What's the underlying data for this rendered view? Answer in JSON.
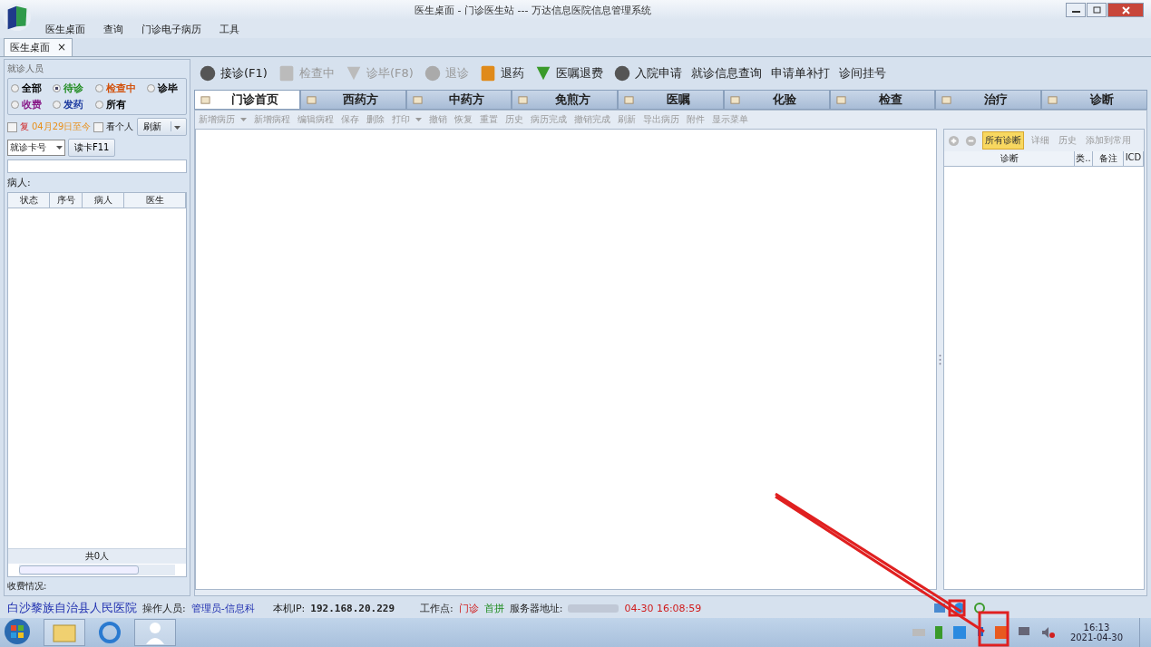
{
  "window": {
    "title": "医生桌面 - 门诊医生站 --- 万达信息医院信息管理系统"
  },
  "menu": [
    "医生桌面",
    "查询",
    "门诊电子病历",
    "工具"
  ],
  "doc_tabs": [
    {
      "label": "医生桌面",
      "selected": true,
      "close": "×"
    }
  ],
  "left_panel": {
    "title": "就诊人员",
    "filters": [
      {
        "label": "全部",
        "selected": false,
        "color": "#000000"
      },
      {
        "label": "待诊",
        "selected": true,
        "color": "#1e8a1e"
      },
      {
        "label": "检查中",
        "selected": false,
        "color": "#d2500a"
      },
      {
        "label": "诊毕",
        "selected": false,
        "color": "#000000"
      },
      {
        "label": "收费",
        "selected": false,
        "color": "#8a1e8a"
      },
      {
        "label": "发药",
        "selected": false,
        "color": "#1e3ca0"
      },
      {
        "label": "所有",
        "selected": false,
        "color": "#000000"
      }
    ],
    "recheck": {
      "label": "复",
      "checked": false
    },
    "date_range": "04月29日至今",
    "personal": {
      "label": "看个人",
      "checked": false
    },
    "refresh_button": "刷新",
    "card_type": "就诊卡号",
    "read_card_button": "读卡F11",
    "patients_label": "病人:",
    "patient_columns": [
      "状态",
      "序号",
      "病人",
      "医生"
    ],
    "patient_count": "共0人",
    "fee_label": "收费情况:"
  },
  "toolbar": [
    {
      "label": "接诊(F1)",
      "kind": "icon",
      "disabled": false
    },
    {
      "label": "检查中",
      "kind": "icon",
      "disabled": true
    },
    {
      "label": "诊毕(F8)",
      "kind": "icon",
      "disabled": true
    },
    {
      "label": "退诊",
      "kind": "icon",
      "disabled": true
    },
    {
      "label": "退药",
      "kind": "icon",
      "disabled": false
    },
    {
      "label": "医嘱退费",
      "kind": "icon",
      "disabled": false
    },
    {
      "label": "入院申请",
      "kind": "icon",
      "disabled": false
    },
    {
      "label": "就诊信息查询",
      "kind": "text",
      "disabled": false
    },
    {
      "label": "申请单补打",
      "kind": "text",
      "disabled": false
    },
    {
      "label": "诊间挂号",
      "kind": "text",
      "disabled": false
    }
  ],
  "module_tabs": [
    {
      "label": "门诊首页",
      "selected": true
    },
    {
      "label": "西药方",
      "selected": false
    },
    {
      "label": "中药方",
      "selected": false
    },
    {
      "label": "免煎方",
      "selected": false
    },
    {
      "label": "医嘱",
      "selected": false
    },
    {
      "label": "化验",
      "selected": false
    },
    {
      "label": "检查",
      "selected": false
    },
    {
      "label": "治疗",
      "selected": false
    },
    {
      "label": "诊断",
      "selected": false
    }
  ],
  "record_toolbar": [
    {
      "label": "新增病历",
      "dropdown": true
    },
    {
      "label": "新增病程",
      "dropdown": false
    },
    {
      "label": "编辑病程",
      "dropdown": false
    },
    {
      "label": "保存",
      "dropdown": false
    },
    {
      "label": "删除",
      "dropdown": false
    },
    {
      "label": "打印",
      "dropdown": true
    },
    {
      "label": "撤销",
      "dropdown": false
    },
    {
      "label": "恢复",
      "dropdown": false
    },
    {
      "label": "重置",
      "dropdown": false
    },
    {
      "label": "历史",
      "dropdown": false
    },
    {
      "label": "病历完成",
      "dropdown": false
    },
    {
      "label": "撤销完成",
      "dropdown": false
    },
    {
      "label": "刷新",
      "dropdown": false
    },
    {
      "label": "导出病历",
      "dropdown": false
    },
    {
      "label": "附件",
      "dropdown": false
    },
    {
      "label": "显示菜单",
      "dropdown": false
    }
  ],
  "diagnosis_panel": {
    "buttons": [
      {
        "label": "所有诊断",
        "selected": true
      },
      {
        "label": "详细",
        "selected": false
      },
      {
        "label": "历史",
        "selected": false
      },
      {
        "label": "添加到常用",
        "selected": false
      }
    ],
    "columns": [
      "诊断",
      "类..",
      "备注",
      "ICD"
    ]
  },
  "status_bar": {
    "hospital": "白沙黎族自治县人民医院",
    "operator_label": "操作人员:",
    "operator": "管理员-信息科",
    "ip_label": "本机IP:",
    "ip": "192.168.20.229",
    "workstation_label": "工作点:",
    "workstation": "门诊",
    "input_method": "首拼",
    "server_label": "服务器地址:",
    "timestamp": "04-30 16:08:59"
  },
  "taskbar": {
    "time": "16:13",
    "date": "2021-04-30"
  }
}
